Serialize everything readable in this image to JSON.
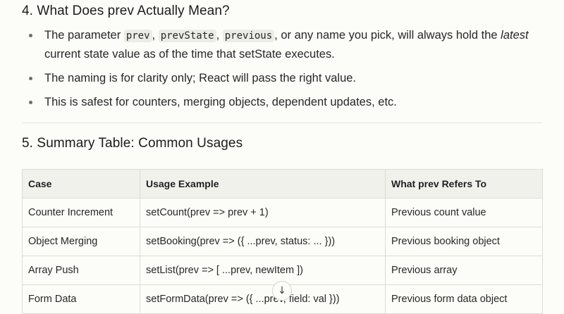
{
  "section4": {
    "heading": "4. What Does prev Actually Mean?",
    "bullets": [
      {
        "pre": "The parameter ",
        "code1": "prev",
        "sep1": ", ",
        "code2": "prevState",
        "sep2": ", ",
        "code3": "previous",
        "mid": ", or any name you pick, will always hold the ",
        "em": "latest",
        "post": " current state value as of the time that setState executes."
      },
      {
        "text": "The naming is for clarity only; React will pass the right value."
      },
      {
        "text": "This is safest for counters, merging objects, dependent updates, etc."
      }
    ]
  },
  "section5": {
    "heading": "5. Summary Table: Common Usages",
    "table": {
      "headers": [
        "Case",
        "Usage Example",
        "What prev Refers To"
      ],
      "rows": [
        [
          "Counter Increment",
          "setCount(prev => prev + 1)",
          "Previous count value"
        ],
        [
          "Object Merging",
          "setBooking(prev => ({ ...prev, status: ... }))",
          "Previous booking object"
        ],
        [
          "Array Push",
          "setList(prev => [ ...prev, newItem ])",
          "Previous array"
        ],
        [
          "Form Data",
          "setFormData(prev => ({ ...prev, field: val }))",
          "Previous form data object"
        ]
      ]
    }
  },
  "scroll_button": {
    "icon": "arrow-down-icon",
    "glyph": "↓"
  }
}
